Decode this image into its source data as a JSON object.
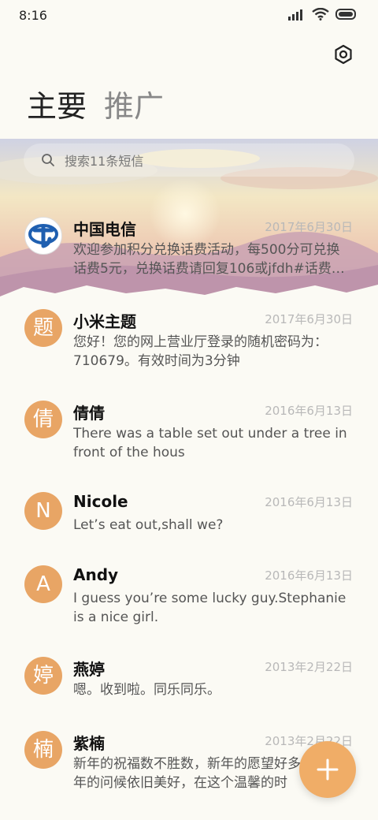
{
  "status_bar": {
    "time": "8:16"
  },
  "tabs": [
    {
      "label": "主要"
    },
    {
      "label": "推广"
    }
  ],
  "search": {
    "placeholder": "搜索11条短信"
  },
  "messages": [
    {
      "avatar": "",
      "sender": "中国电信",
      "date": "2017年6月30日",
      "preview": "欢迎参加积分兑换话费活动，每500分可兑换话费5元，兑换话费请回复106或jfdh#话费…"
    },
    {
      "avatar": "题",
      "sender": "小米主题",
      "date": "2017年6月30日",
      "preview": "您好！您的网上营业厅登录的随机密码为：710679。有效时间为3分钟"
    },
    {
      "avatar": "倩",
      "sender": "倩倩",
      "date": "2016年6月13日",
      "preview": "There was a table set out under a tree in front of the hous"
    },
    {
      "avatar": "N",
      "sender": "Nicole",
      "date": "2016年6月13日",
      "preview": "Let’s eat out,shall we?"
    },
    {
      "avatar": "A",
      "sender": "Andy",
      "date": "2016年6月13日",
      "preview": "I guess you’re some lucky guy.Stephanie is a nice girl."
    },
    {
      "avatar": "婷",
      "sender": "燕婷",
      "date": "2013年2月22日",
      "preview": "嗯。收到啦。同乐同乐。"
    },
    {
      "avatar": "楠",
      "sender": "紫楠",
      "date": "2013年2月22日",
      "preview": "新年的祝福数不胜数，新年的愿望好多多，新年的问候依旧美好，在这个温馨的时"
    }
  ],
  "colors": {
    "avatar": "#e8a565",
    "fab": "#f0ad67",
    "background": "#fbfaf4"
  },
  "icons": {
    "settings": "hexagon-settings-icon",
    "search": "search-icon",
    "fab": "plus-icon"
  }
}
